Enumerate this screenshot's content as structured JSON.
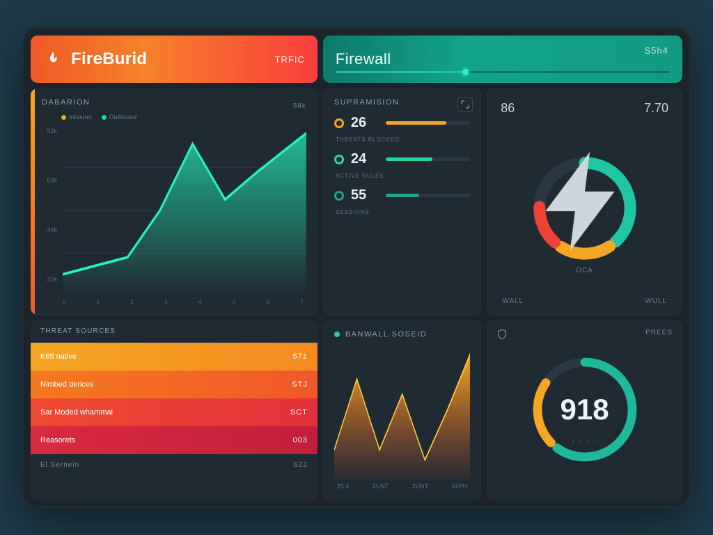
{
  "colors": {
    "accent_green": "#22d3a4",
    "accent_orange": "#f5a623",
    "accent_red": "#ef4136",
    "bg_card": "#1f2a33"
  },
  "header": {
    "brand_name": "FireBurid",
    "brand_tag": "TRFIC",
    "tab_label": "Firewall",
    "tab_code": "S5h4",
    "progress_pct": 38
  },
  "traffic_panel": {
    "title": "DABARION",
    "legend": [
      {
        "color": "#f5a623",
        "label": "Inbound"
      },
      {
        "color": "#22d3a4",
        "label": "Outbound"
      }
    ],
    "y_ticks": [
      "92k",
      "68k",
      "44k",
      "20k"
    ],
    "x_ticks": [
      "0",
      "1",
      "2",
      "3",
      "4",
      "5",
      "6",
      "7"
    ],
    "side_badge": "58k"
  },
  "stats_panel": {
    "title": "SUPRAMISION",
    "rows": [
      {
        "dot": "o",
        "value": "26",
        "bar_pct": 72,
        "bar_color": "#f5a623",
        "sub": "Threats blocked"
      },
      {
        "dot": "g",
        "value": "24",
        "bar_pct": 55,
        "bar_color": "#22d3a4",
        "sub": "Active rules"
      },
      {
        "dot": "t",
        "value": "55",
        "bar_pct": 40,
        "bar_color": "#1fa789",
        "sub": "Sessions"
      }
    ]
  },
  "gauge_panel": {
    "left_value": "86",
    "right_value": "7.70",
    "center_sub": "OCA",
    "foot_left": "WALL",
    "foot_right": "WULL"
  },
  "list_panel": {
    "title": "THREAT SOURCES",
    "rows": [
      {
        "label": "K65 native",
        "value": "571"
      },
      {
        "label": "Nimbed derices",
        "value": "STJ"
      },
      {
        "label": "Sar Moded whammal",
        "value": "SCT"
      },
      {
        "label": "Reasorets",
        "value": "003"
      }
    ],
    "foot_left": "El Sernein",
    "foot_right": "S22"
  },
  "mini_panel": {
    "title": "BANWALL SOSEID",
    "x_ticks": [
      "25:4",
      "2UNT",
      "2UNT",
      "24PH"
    ]
  },
  "score_panel": {
    "top_label": "PREES",
    "value": "918",
    "sub": "· · · ·"
  },
  "chart_data": [
    {
      "type": "area",
      "title": "DABARION",
      "x": [
        0,
        1,
        2,
        3,
        4,
        5,
        6,
        7
      ],
      "series": [
        {
          "name": "Outbound",
          "values": [
            22,
            26,
            30,
            48,
            86,
            60,
            74,
            92
          ],
          "color": "#22d3a4"
        }
      ],
      "ylim": [
        20,
        92
      ],
      "ylabel": "k",
      "xlabel": ""
    },
    {
      "type": "area",
      "title": "BANWALL SOSEID",
      "categories": [
        "25:4",
        "2UNT",
        "2UNT",
        "24PH"
      ],
      "values": [
        18,
        62,
        30,
        85
      ],
      "ylim": [
        0,
        100
      ]
    },
    {
      "type": "pie",
      "title": "Gauge",
      "categories": [
        "green",
        "orange",
        "red",
        "empty"
      ],
      "values": [
        38,
        18,
        14,
        30
      ]
    },
    {
      "type": "pie",
      "title": "Score",
      "categories": [
        "teal",
        "orange",
        "gap"
      ],
      "values": [
        60,
        22,
        18
      ],
      "center_value": 918
    }
  ]
}
